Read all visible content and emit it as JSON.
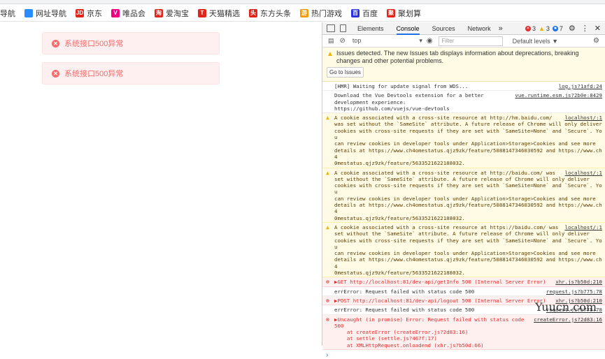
{
  "bookmarks": [
    {
      "label": "导航",
      "color": "#ff6600"
    },
    {
      "label": "网址导航",
      "color": "#2a8cff"
    },
    {
      "label": "京东",
      "color": "#e1251b",
      "glyph": "JD"
    },
    {
      "label": "唯品会",
      "color": "#f10180",
      "glyph": "V"
    },
    {
      "label": "爱淘宝",
      "color": "#e1251b",
      "glyph": "淘"
    },
    {
      "label": "天猫精选",
      "color": "#e1251b",
      "glyph": "T"
    },
    {
      "label": "东方头条",
      "color": "#e1251b",
      "glyph": "头"
    },
    {
      "label": "热门游戏",
      "color": "#f59a00",
      "glyph": "游"
    },
    {
      "label": "百度",
      "color": "#2932e1",
      "glyph": "百"
    },
    {
      "label": "聚划算",
      "color": "#e1251b",
      "glyph": "聚"
    }
  ],
  "toasts": [
    "系统接口500异常",
    "系统接口500异常"
  ],
  "devtools": {
    "tabs": [
      "Elements",
      "Console",
      "Sources",
      "Network"
    ],
    "more": "»",
    "errors": "3",
    "warnings": "3",
    "info": "7",
    "context": "top",
    "filter_placeholder": "Filter",
    "levels": "Default levels ▼",
    "issues_text": "Issues detected. The new Issues tab displays information about deprecations, breaking changes and other potential problems.",
    "issues_button": "Go to Issues"
  },
  "console": [
    {
      "type": "log",
      "text": "[HMR] Waiting for update signal from WDS...",
      "src": "log.js?1afd:24"
    },
    {
      "type": "log",
      "text": "Download the Vue Devtools extension for a better\ndevelopment experience:\nhttps://github.com/vuejs/vue-devtools",
      "src": "vue.runtime.esm.js?2b0e:8429"
    },
    {
      "type": "warn",
      "text": "A cookie associated with a cross-site resource at http://hm.baidu.com/\nwas set without the `SameSite` attribute. A future release of Chrome will only deliver\ncookies with cross-site requests if they are set with `SameSite=None` and `Secure`. You\ncan review cookies in developer tools under Application>Storage>Cookies and see more\ndetails at https://www.ch4omestatus.qjz9zk/feature/5088147346030592 and https://www.ch4\n0mestatus.qjz9zk/feature/5633521622188032.",
      "src": "localhost/:1"
    },
    {
      "type": "warn",
      "text": "A cookie associated with a cross-site resource at http://baidu.com/ was\nset without the `SameSite` attribute. A future release of Chrome will only deliver\ncookies with cross-site requests if they are set with `SameSite=None` and `Secure`. You\ncan review cookies in developer tools under Application>Storage>Cookies and see more\ndetails at https://www.ch4omestatus.qjz9zk/feature/5088147346030592 and https://www.ch4\n0mestatus.qjz9zk/feature/5633521622188032.",
      "src": "localhost/:1"
    },
    {
      "type": "warn",
      "text": "A cookie associated with a cross-site resource at https://baidu.com/ was\nset without the `SameSite` attribute. A future release of Chrome will only deliver\ncookies with cross-site requests if they are set with `SameSite=None` and `Secure`. You\ncan review cookies in developer tools under Application>Storage>Cookies and see more\ndetails at https://www.ch4omestatus.qjz9zk/feature/5088147346030592 and https://www.ch4\n0mestatus.qjz9zk/feature/5633521622188032.",
      "src": "localhost/:1"
    },
    {
      "type": "err",
      "text": "▶GET http://localhost:81/dev-api/getInfo 500 (Internal Server Error)",
      "src": "xhr.js?b50d:210"
    },
    {
      "type": "log",
      "text": "errError: Request failed with status code 500",
      "src": "request.js?b775:78"
    },
    {
      "type": "err",
      "text": "▶POST http://localhost:81/dev-api/logout 500 (Internal Server Error)",
      "src": "xhr.js?b50d:210"
    },
    {
      "type": "log",
      "text": "errError: Request failed with status code 500",
      "src": "request.js?b775:78"
    },
    {
      "type": "err",
      "text": "▶Uncaught (in promise) Error: Request failed with status code\n500\n    at createError (createError.js?2d83:16)\n    at settle (settle.js?467f:17)\n    at XMLHttpRequest.onloadend (xhr.js?b50d:66)",
      "src": "createError.js?2d83:16"
    }
  ],
  "prompt": "›",
  "watermark": "Yuucn.com"
}
